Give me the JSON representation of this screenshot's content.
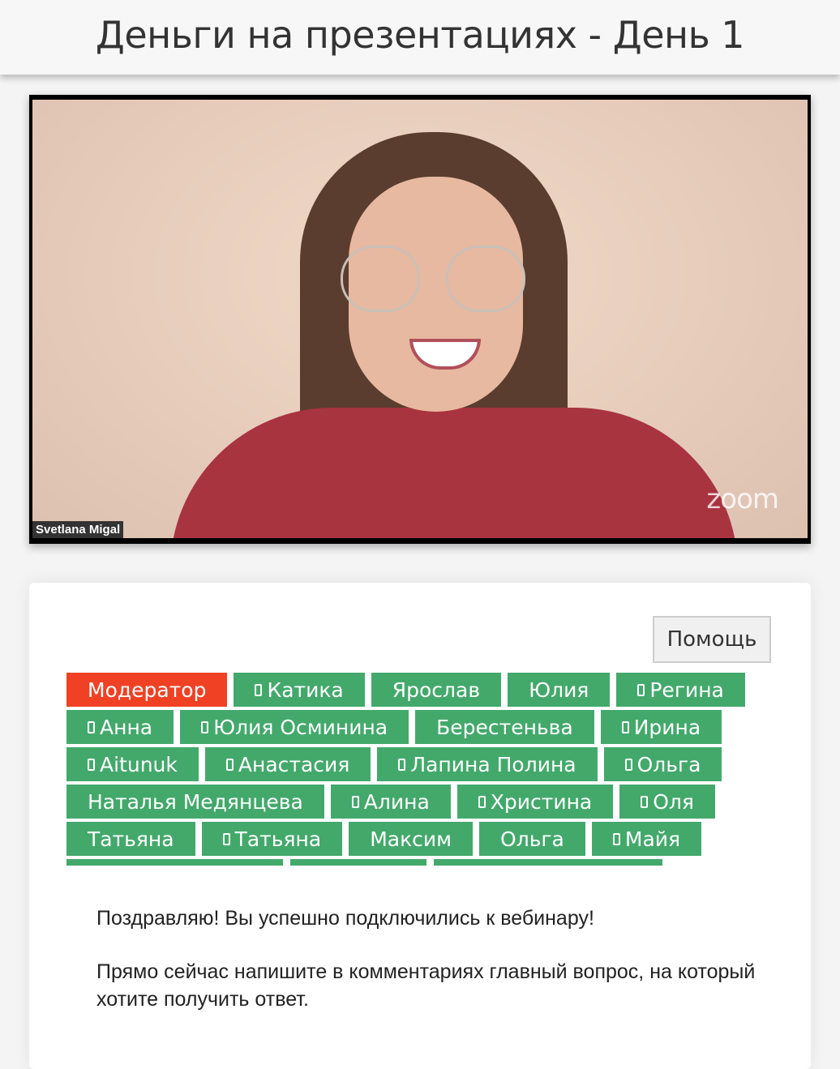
{
  "header": {
    "title": "Деньги на презентациях - День 1"
  },
  "video": {
    "participant_name": "Svetlana Migal",
    "watermark": "zoom"
  },
  "panel": {
    "help_label": "Помощь",
    "rows": [
      [
        {
          "name": "Модератор",
          "role": "moderator",
          "mobile": false
        },
        {
          "name": "Катика",
          "mobile": true
        },
        {
          "name": "Ярослав",
          "mobile": false
        },
        {
          "name": "Юлия",
          "mobile": false
        },
        {
          "name": "Регина",
          "mobile": true
        }
      ],
      [
        {
          "name": "Анна",
          "mobile": true
        },
        {
          "name": "Юлия Осминина",
          "mobile": true
        },
        {
          "name": "Берестеньва",
          "mobile": false
        },
        {
          "name": "Ирина",
          "mobile": true
        }
      ],
      [
        {
          "name": "Aitunuk",
          "mobile": true
        },
        {
          "name": "Анастасия",
          "mobile": true
        },
        {
          "name": "Лапина Полина",
          "mobile": true
        },
        {
          "name": "Ольга",
          "mobile": true
        }
      ],
      [
        {
          "name": "Наталья Медянцева",
          "mobile": false
        },
        {
          "name": "Алина",
          "mobile": true
        },
        {
          "name": "Христина",
          "mobile": true
        },
        {
          "name": "Оля",
          "mobile": true
        }
      ],
      [
        {
          "name": "Татьяна",
          "mobile": false
        },
        {
          "name": "Татьяна",
          "mobile": true
        },
        {
          "name": "Максим",
          "mobile": false
        },
        {
          "name": "Ольга",
          "mobile": false
        },
        {
          "name": "Майя",
          "mobile": true
        }
      ]
    ],
    "message_1": "Поздравляю! Вы успешно подключились к вебинару!",
    "message_2": "Прямо сейчас напишите в комментариях главный вопрос, на который хотите получить ответ."
  },
  "colors": {
    "chip": "#43a96b",
    "moderator": "#f04124"
  }
}
